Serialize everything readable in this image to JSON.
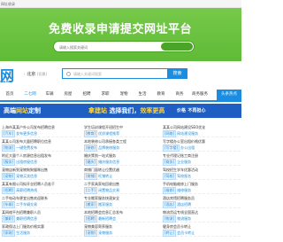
{
  "topbar": {
    "text": "网址收录"
  },
  "banner": {
    "title": "免费收录申请提交网址平台",
    "search_placeholder": "请输入搜索关键词",
    "search_button": ""
  },
  "header": {
    "logo_text": "网",
    "logo_sub": "ONLINE",
    "city": "北京",
    "city_switch": "[切换]",
    "search_placeholder": "请输入关键词搜索",
    "search_button": "搜索"
  },
  "nav": {
    "items": [
      {
        "label": "首页"
      },
      {
        "label": "二七网"
      },
      {
        "label": "车辆"
      },
      {
        "label": "房屋"
      },
      {
        "label": "招聘"
      },
      {
        "label": "求职"
      },
      {
        "label": "宠物"
      },
      {
        "label": "生活"
      },
      {
        "label": "教育"
      },
      {
        "label": "商务"
      },
      {
        "label": "商务服务"
      },
      {
        "label": "头条热点"
      }
    ]
  },
  "ad": {
    "part1_a": "高端",
    "part1_b": "网站",
    "part1_c": "定制",
    "part2_a": "拿建站",
    "part2_b": "选择我们，",
    "part2_c": "效率更高",
    "part3": "价格",
    "part3_sub": "不再担心"
  },
  "columns": [
    {
      "rows": [
        {
          "title": "上海市某某户外公司发布招聘信息",
          "tag": "[汽车]",
          "meta": "发布更多信息"
        },
        {
          "title": "某某公司发布大量招聘职位信息",
          "tag": "[物流]",
          "meta": "一键免费发布"
        },
        {
          "title": "附近大量个人房源信息出租发布",
          "tag": "[服务]",
          "meta": "出租房屋信息"
        },
        {
          "title": "宠物店新到宠物狗狗猫咪出售",
          "tag": "[宠物]",
          "meta": "宠物买卖信息"
        },
        {
          "title": "某某有限公司拟开业招聘人员若干",
          "tag": "[招聘]",
          "meta": "高薪招聘热线"
        },
        {
          "title": "二手电动车便宜出售欢迎联系",
          "tag": "[车辆]",
          "meta": "二手车辆交易"
        },
        {
          "title": "某网络平台招聘兼职人员",
          "tag": "[兼职]",
          "meta": "兼职招聘信息"
        },
        {
          "title": "家政保洁上门服务价格实惠",
          "tag": "[家政]",
          "meta": "生活服务"
        }
      ]
    },
    {
      "rows": [
        {
          "title": "学生培训课程开班招生中",
          "tag": "[教育]",
          "meta": "优质课程推荐"
        },
        {
          "title": "本地装修公司承接各类工程",
          "tag": "[装修]",
          "meta": "品牌装修服务"
        },
        {
          "title": "婚庆策划一站式服务",
          "tag": "[婚庆]",
          "meta": "婚庆服务信息"
        },
        {
          "title": "商铺门面转让位置优越",
          "tag": "[商铺]",
          "meta": "旺铺转让"
        },
        {
          "title": "二手家具家电回收出售",
          "tag": "[二手]",
          "meta": "闲置物品交易"
        },
        {
          "title": "专业搬家服务快速安全",
          "tag": "[搬家]",
          "meta": "搬家服务"
        },
        {
          "title": "本地招聘会信息汇总发布",
          "tag": "[招聘]",
          "meta": "最新招聘会"
        },
        {
          "title": "宠物美容寄养服务",
          "tag": "[宠物]",
          "meta": "宠物服务"
        }
      ]
    },
    {
      "rows": [
        {
          "title": "某某公司网站建设SEO优化",
          "tag": "[网络]",
          "meta": "网站建设服务"
        },
        {
          "title": "写字楼办公室出租价格优惠",
          "tag": "[写字楼]",
          "meta": "办公出租"
        },
        {
          "title": "专业代理记账工商注册",
          "tag": "[商务]",
          "meta": "企业服务"
        },
        {
          "title": "驾校招生学车优惠活动",
          "tag": "[驾校]",
          "meta": "驾校报名"
        },
        {
          "title": "手机电脑维修上门服务",
          "tag": "[维修]",
          "meta": "维修服务"
        },
        {
          "title": "酒店宾馆招聘服务员",
          "tag": "[酒店]",
          "meta": "酒店招聘"
        },
        {
          "title": "物流货运专线全国直达",
          "tag": "[物流]",
          "meta": "物流服务"
        },
        {
          "title": "健身房会员卡转让",
          "tag": "[转让]",
          "meta": "会员卡转让"
        }
      ]
    }
  ]
}
